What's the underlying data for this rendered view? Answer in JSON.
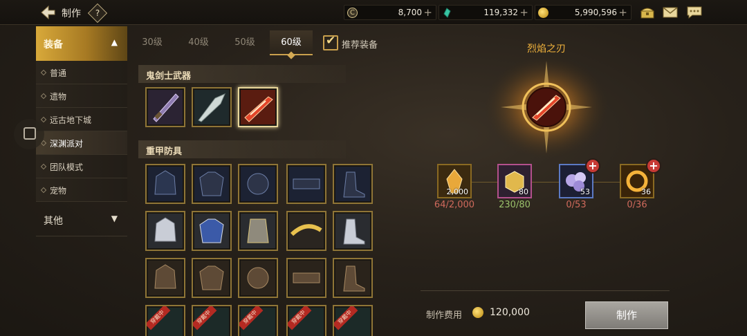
{
  "header": {
    "title": "制作",
    "help": "?"
  },
  "currencies": [
    {
      "name": "gold-c",
      "value": "8,700",
      "color": "#d4c28a"
    },
    {
      "name": "crystal",
      "value": "119,332",
      "color": "#37c4a2"
    },
    {
      "name": "coin",
      "value": "5,990,596",
      "color": "#e1b23a"
    }
  ],
  "sidebar": {
    "main_category": "装备",
    "items": [
      {
        "label": "普通"
      },
      {
        "label": "遗物"
      },
      {
        "label": "远古地下城"
      },
      {
        "label": "深渊派对",
        "active": true
      },
      {
        "label": "团队模式"
      },
      {
        "label": "宠物"
      }
    ],
    "other_category": "其他"
  },
  "tabs": [
    "30级",
    "40级",
    "50级",
    "60级"
  ],
  "active_tab": "60级",
  "recommend_label": "推荐装备",
  "sections": {
    "weapons": "鬼剑士武器",
    "armor": "重甲防具"
  },
  "wear_tag": "穿戴中",
  "detail": {
    "item_name": "烈焰之刃",
    "materials": [
      {
        "qty_badge": "2,000",
        "count": "64/2,000",
        "enough": false
      },
      {
        "qty_badge": "80",
        "count": "230/80",
        "enough": true
      },
      {
        "qty_badge": "53",
        "count": "0/53",
        "enough": false
      },
      {
        "qty_badge": "36",
        "count": "0/36",
        "enough": false
      }
    ],
    "fee_label": "制作费用",
    "fee_value": "120,000",
    "craft_button": "制作"
  }
}
